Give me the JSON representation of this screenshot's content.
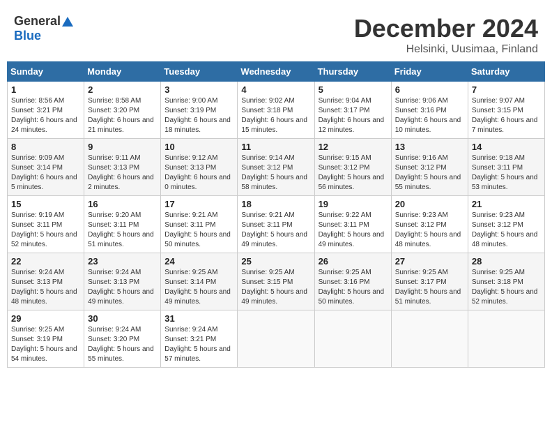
{
  "header": {
    "logo_general": "General",
    "logo_blue": "Blue",
    "month_title": "December 2024",
    "location": "Helsinki, Uusimaa, Finland"
  },
  "weekdays": [
    "Sunday",
    "Monday",
    "Tuesday",
    "Wednesday",
    "Thursday",
    "Friday",
    "Saturday"
  ],
  "weeks": [
    [
      {
        "day": "1",
        "sunrise": "Sunrise: 8:56 AM",
        "sunset": "Sunset: 3:21 PM",
        "daylight": "Daylight: 6 hours and 24 minutes."
      },
      {
        "day": "2",
        "sunrise": "Sunrise: 8:58 AM",
        "sunset": "Sunset: 3:20 PM",
        "daylight": "Daylight: 6 hours and 21 minutes."
      },
      {
        "day": "3",
        "sunrise": "Sunrise: 9:00 AM",
        "sunset": "Sunset: 3:19 PM",
        "daylight": "Daylight: 6 hours and 18 minutes."
      },
      {
        "day": "4",
        "sunrise": "Sunrise: 9:02 AM",
        "sunset": "Sunset: 3:18 PM",
        "daylight": "Daylight: 6 hours and 15 minutes."
      },
      {
        "day": "5",
        "sunrise": "Sunrise: 9:04 AM",
        "sunset": "Sunset: 3:17 PM",
        "daylight": "Daylight: 6 hours and 12 minutes."
      },
      {
        "day": "6",
        "sunrise": "Sunrise: 9:06 AM",
        "sunset": "Sunset: 3:16 PM",
        "daylight": "Daylight: 6 hours and 10 minutes."
      },
      {
        "day": "7",
        "sunrise": "Sunrise: 9:07 AM",
        "sunset": "Sunset: 3:15 PM",
        "daylight": "Daylight: 6 hours and 7 minutes."
      }
    ],
    [
      {
        "day": "8",
        "sunrise": "Sunrise: 9:09 AM",
        "sunset": "Sunset: 3:14 PM",
        "daylight": "Daylight: 6 hours and 5 minutes."
      },
      {
        "day": "9",
        "sunrise": "Sunrise: 9:11 AM",
        "sunset": "Sunset: 3:13 PM",
        "daylight": "Daylight: 6 hours and 2 minutes."
      },
      {
        "day": "10",
        "sunrise": "Sunrise: 9:12 AM",
        "sunset": "Sunset: 3:13 PM",
        "daylight": "Daylight: 6 hours and 0 minutes."
      },
      {
        "day": "11",
        "sunrise": "Sunrise: 9:14 AM",
        "sunset": "Sunset: 3:12 PM",
        "daylight": "Daylight: 5 hours and 58 minutes."
      },
      {
        "day": "12",
        "sunrise": "Sunrise: 9:15 AM",
        "sunset": "Sunset: 3:12 PM",
        "daylight": "Daylight: 5 hours and 56 minutes."
      },
      {
        "day": "13",
        "sunrise": "Sunrise: 9:16 AM",
        "sunset": "Sunset: 3:12 PM",
        "daylight": "Daylight: 5 hours and 55 minutes."
      },
      {
        "day": "14",
        "sunrise": "Sunrise: 9:18 AM",
        "sunset": "Sunset: 3:11 PM",
        "daylight": "Daylight: 5 hours and 53 minutes."
      }
    ],
    [
      {
        "day": "15",
        "sunrise": "Sunrise: 9:19 AM",
        "sunset": "Sunset: 3:11 PM",
        "daylight": "Daylight: 5 hours and 52 minutes."
      },
      {
        "day": "16",
        "sunrise": "Sunrise: 9:20 AM",
        "sunset": "Sunset: 3:11 PM",
        "daylight": "Daylight: 5 hours and 51 minutes."
      },
      {
        "day": "17",
        "sunrise": "Sunrise: 9:21 AM",
        "sunset": "Sunset: 3:11 PM",
        "daylight": "Daylight: 5 hours and 50 minutes."
      },
      {
        "day": "18",
        "sunrise": "Sunrise: 9:21 AM",
        "sunset": "Sunset: 3:11 PM",
        "daylight": "Daylight: 5 hours and 49 minutes."
      },
      {
        "day": "19",
        "sunrise": "Sunrise: 9:22 AM",
        "sunset": "Sunset: 3:11 PM",
        "daylight": "Daylight: 5 hours and 49 minutes."
      },
      {
        "day": "20",
        "sunrise": "Sunrise: 9:23 AM",
        "sunset": "Sunset: 3:12 PM",
        "daylight": "Daylight: 5 hours and 48 minutes."
      },
      {
        "day": "21",
        "sunrise": "Sunrise: 9:23 AM",
        "sunset": "Sunset: 3:12 PM",
        "daylight": "Daylight: 5 hours and 48 minutes."
      }
    ],
    [
      {
        "day": "22",
        "sunrise": "Sunrise: 9:24 AM",
        "sunset": "Sunset: 3:13 PM",
        "daylight": "Daylight: 5 hours and 48 minutes."
      },
      {
        "day": "23",
        "sunrise": "Sunrise: 9:24 AM",
        "sunset": "Sunset: 3:13 PM",
        "daylight": "Daylight: 5 hours and 49 minutes."
      },
      {
        "day": "24",
        "sunrise": "Sunrise: 9:25 AM",
        "sunset": "Sunset: 3:14 PM",
        "daylight": "Daylight: 5 hours and 49 minutes."
      },
      {
        "day": "25",
        "sunrise": "Sunrise: 9:25 AM",
        "sunset": "Sunset: 3:15 PM",
        "daylight": "Daylight: 5 hours and 49 minutes."
      },
      {
        "day": "26",
        "sunrise": "Sunrise: 9:25 AM",
        "sunset": "Sunset: 3:16 PM",
        "daylight": "Daylight: 5 hours and 50 minutes."
      },
      {
        "day": "27",
        "sunrise": "Sunrise: 9:25 AM",
        "sunset": "Sunset: 3:17 PM",
        "daylight": "Daylight: 5 hours and 51 minutes."
      },
      {
        "day": "28",
        "sunrise": "Sunrise: 9:25 AM",
        "sunset": "Sunset: 3:18 PM",
        "daylight": "Daylight: 5 hours and 52 minutes."
      }
    ],
    [
      {
        "day": "29",
        "sunrise": "Sunrise: 9:25 AM",
        "sunset": "Sunset: 3:19 PM",
        "daylight": "Daylight: 5 hours and 54 minutes."
      },
      {
        "day": "30",
        "sunrise": "Sunrise: 9:24 AM",
        "sunset": "Sunset: 3:20 PM",
        "daylight": "Daylight: 5 hours and 55 minutes."
      },
      {
        "day": "31",
        "sunrise": "Sunrise: 9:24 AM",
        "sunset": "Sunset: 3:21 PM",
        "daylight": "Daylight: 5 hours and 57 minutes."
      },
      null,
      null,
      null,
      null
    ]
  ]
}
